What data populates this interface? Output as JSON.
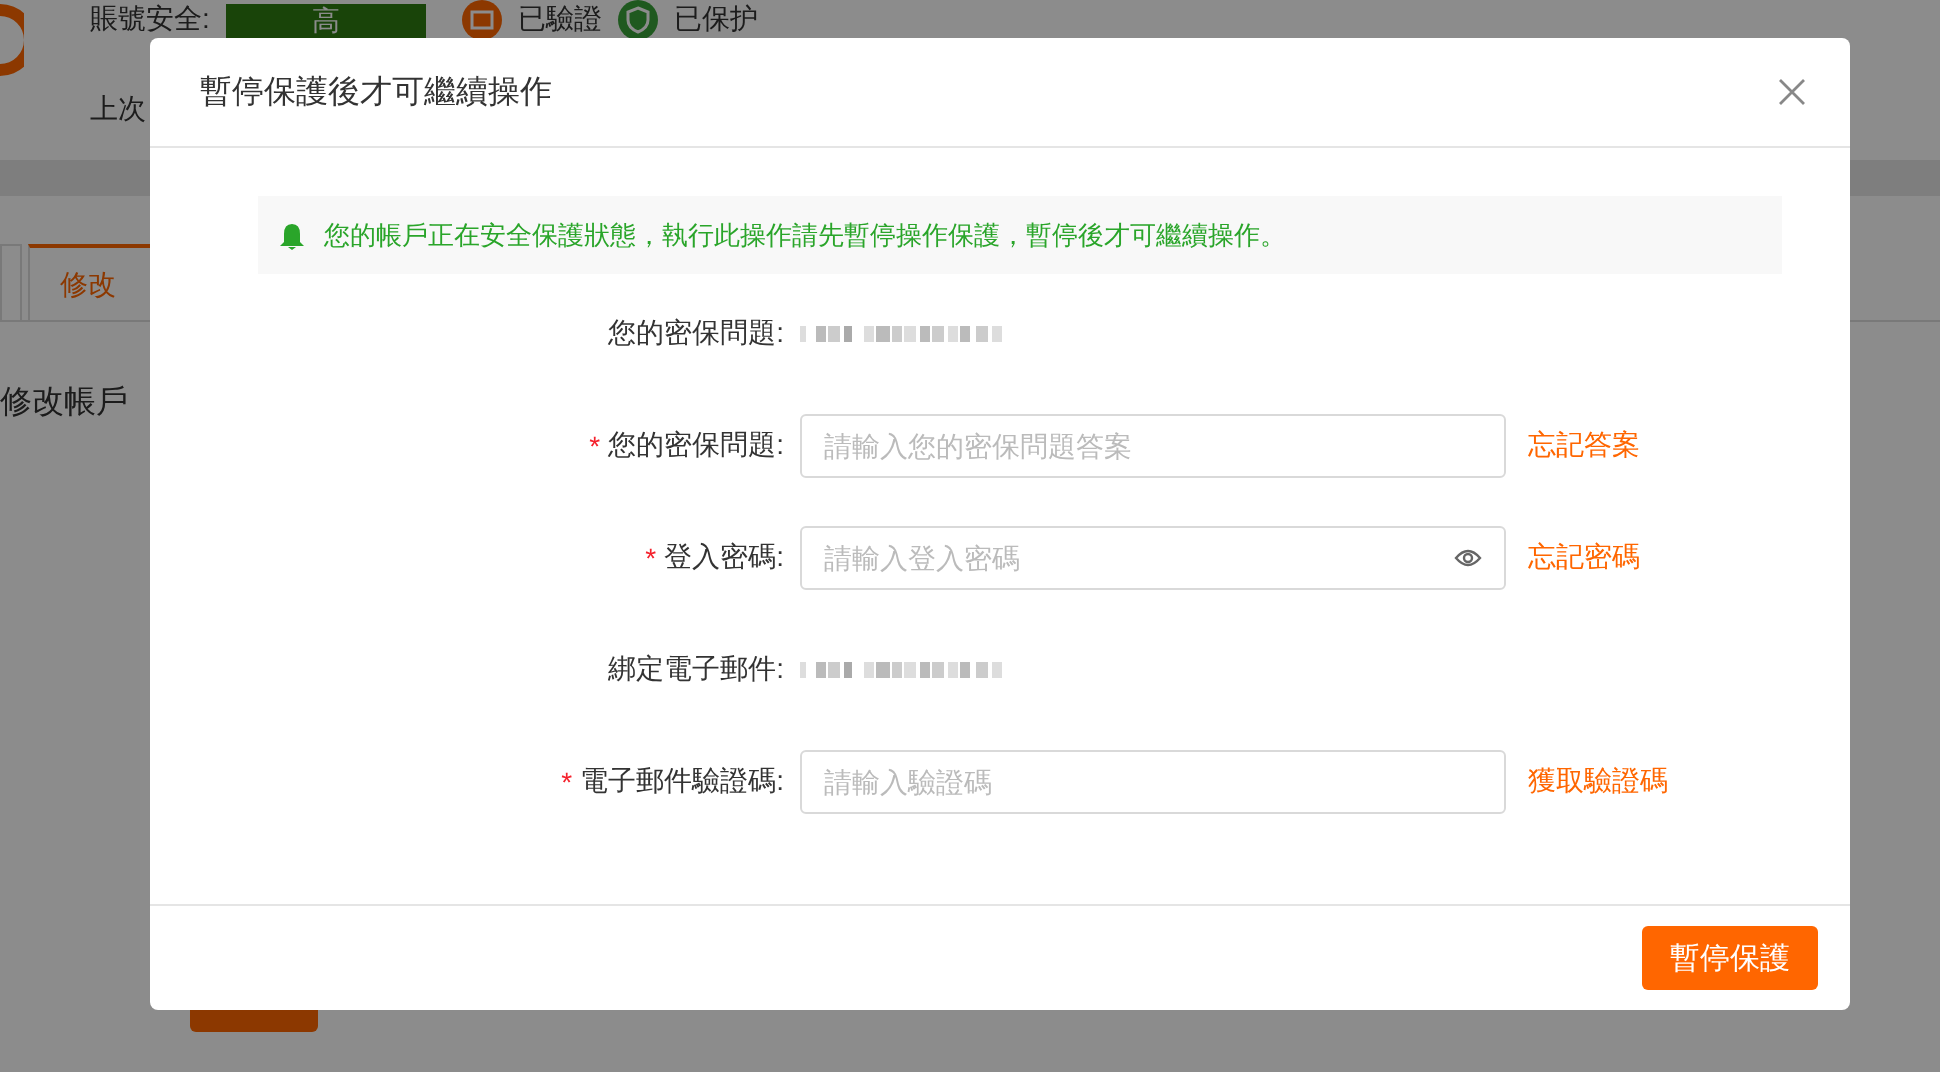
{
  "background_page": {
    "security_label": "賬號安全:",
    "security_level": "高",
    "badges": [
      {
        "kind": "mail",
        "label": "已驗證"
      },
      {
        "kind": "shield",
        "label": "已保护"
      }
    ],
    "last_login_label": "上次",
    "tabs": [
      {
        "selected": false
      },
      {
        "label": "修改",
        "selected": true
      }
    ],
    "section_title": "修改帳戶"
  },
  "dialog": {
    "title": "暫停保護後才可繼續操作",
    "alert": "您的帳戶正在安全保護狀態，執行此操作請先暫停操作保護，暫停後才可繼續操作。",
    "rows": [
      {
        "kind": "static",
        "label": "您的密保問題:"
      },
      {
        "kind": "input",
        "required_mark": "*",
        "label": "您的密保問題:",
        "placeholder": "請輸入您的密保問題答案",
        "link": "忘記答案"
      },
      {
        "kind": "input",
        "required_mark": "*",
        "label": "登入密碼:",
        "placeholder": "請輸入登入密碼",
        "password": true,
        "link": "忘記密碼"
      },
      {
        "kind": "static",
        "label": "綁定電子郵件:"
      },
      {
        "kind": "input",
        "required_mark": "*",
        "label": "電子郵件驗證碼:",
        "placeholder": "請輸入驗證碼",
        "link": "獲取驗證碼"
      }
    ],
    "submit_button": "暫停保護"
  }
}
